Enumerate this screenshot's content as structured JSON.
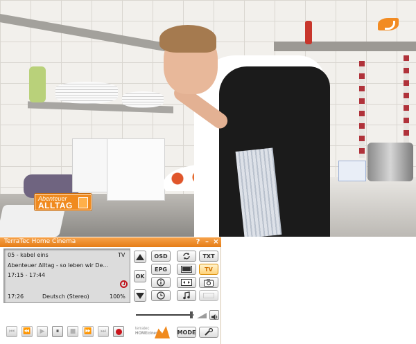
{
  "video": {
    "show_logo_line1": "Abenteuer",
    "show_logo_line2": "ALLTAG"
  },
  "player": {
    "title": "TerraTec Home Cinema",
    "window_buttons": [
      "?",
      "–",
      "×"
    ],
    "info": {
      "channel": "05 - kabel eins",
      "mode": "TV",
      "program_title": "Abenteuer Alltag - so leben wir De...",
      "time_range": "17:15 - 17:44",
      "current_time": "17:26",
      "audio": "Deutsch (Stereo)",
      "volume": "100%"
    },
    "buttons": {
      "osd": "OSD",
      "epg": "EPG",
      "ok": "OK",
      "txt": "TXT",
      "tv": "TV",
      "mode": "MODE"
    },
    "brand": {
      "line1": "terratec",
      "line2": "HOMEcinema"
    },
    "volume_level": 0.95
  },
  "colors": {
    "accent": "#f08a1e",
    "record": "#c9141b",
    "info_bg": "#dcdcdc"
  }
}
